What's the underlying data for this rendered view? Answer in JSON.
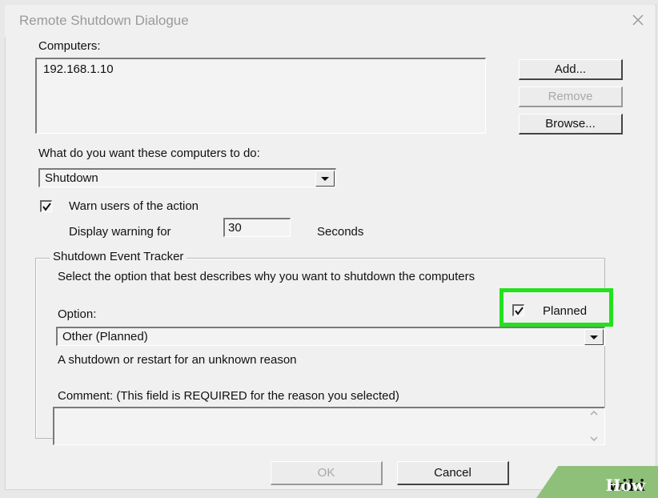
{
  "window": {
    "title": "Remote Shutdown Dialogue"
  },
  "computers": {
    "label": "Computers:",
    "items": [
      "192.168.1.10"
    ],
    "add_label": "Add...",
    "remove_label": "Remove",
    "browse_label": "Browse..."
  },
  "action": {
    "label": "What do you want these computers to do:",
    "selected": "Shutdown"
  },
  "warn": {
    "checked": true,
    "label": "Warn users of the action",
    "display_label": "Display warning for",
    "seconds_value": "30",
    "seconds_label": "Seconds"
  },
  "tracker": {
    "title": "Shutdown Event Tracker",
    "description": "Select the option that best describes why you want to shutdown the computers",
    "option_label": "Option:",
    "planned_checked": true,
    "planned_label": "Planned",
    "option_selected": "Other (Planned)",
    "reason_text": "A shutdown or restart for an unknown reason",
    "comment_label": "Comment: (This field is REQUIRED for the reason you selected)",
    "comment_value": ""
  },
  "buttons": {
    "ok_label": "OK",
    "cancel_label": "Cancel"
  },
  "watermark": {
    "prefix": "wiki",
    "suffix": "How"
  },
  "colors": {
    "highlight": "#22e11d",
    "dialog_bg": "#f0f0f0",
    "watermark_bg": "#8ec07a"
  }
}
